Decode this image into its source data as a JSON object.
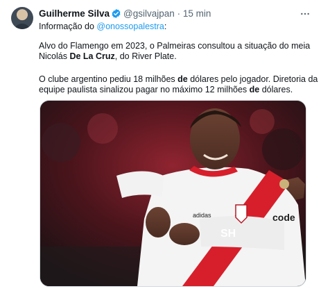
{
  "tweet": {
    "author_name": "Guilherme Silva",
    "author_handle": "@gsilvajpan",
    "separator": "·",
    "time": "15 min",
    "line1_prefix": "Informação do ",
    "line1_mention": "@onossopalestra",
    "line1_suffix": ":",
    "p1_line1": "Alvo do Flamengo em 2023, o Palmeiras consultou a situação do meia",
    "p1_line2_prefix": "Nicolás ",
    "p1_line2_bold": "De La Cruz",
    "p1_line2_suffix": ", do River Plate.",
    "p2_line1_prefix": "O clube argentino pediu 18 milhões ",
    "p2_line1_bold": "de",
    "p2_line1_suffix": " dólares pelo jogador. Diretoria da",
    "p2_line2_prefix": "equipe paulista sinalizou pagar no máximo 12 milhões ",
    "p2_line2_bold": "de",
    "p2_line2_suffix": " dólares."
  },
  "media": {
    "sponsor_text": "code",
    "chest_text": "SH",
    "kit_brand": "adidas"
  },
  "colors": {
    "accent": "#1d9bf0",
    "secondary_text": "#536471",
    "jersey_red": "#d71f2b"
  }
}
